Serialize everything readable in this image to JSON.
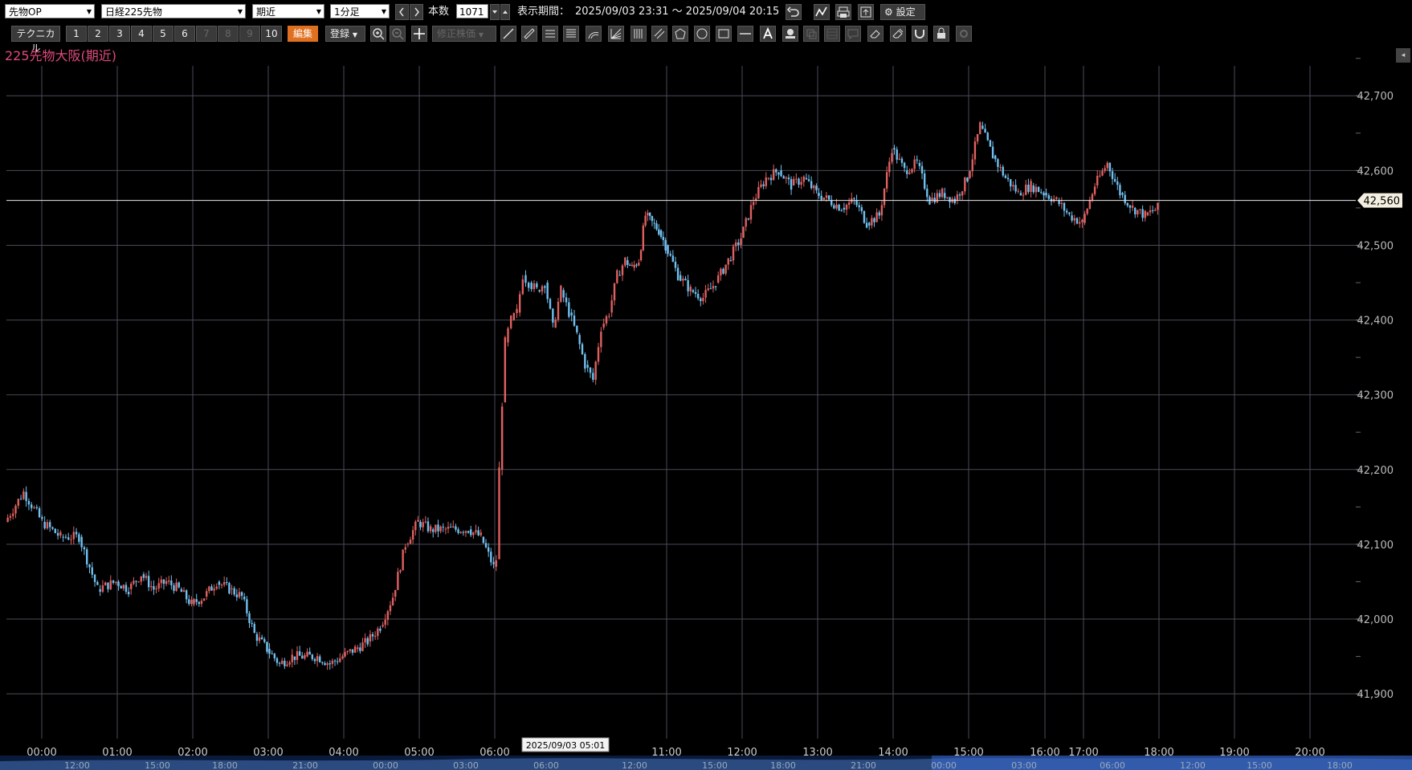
{
  "toolbar": {
    "category_select": "先物OP",
    "instrument_select": "日経225先物",
    "contract_select": "期近",
    "interval_select": "1分足",
    "bars_label": "本数",
    "bars_value": "1071",
    "period_label": "表示期間：",
    "period_value": "2025/09/03 23:31 〜 2025/09/04 20:15",
    "settings_label": "設定",
    "technical_label": "テクニカル",
    "numbers": [
      "1",
      "2",
      "3",
      "4",
      "5",
      "6",
      "7",
      "8",
      "9",
      "10"
    ],
    "edit_label": "編集",
    "register_label": "登録",
    "adjust_label": "修正株価"
  },
  "colors": {
    "up": "#e06060",
    "down": "#70c0f0",
    "grid": "#4a4a5a",
    "title": "#e04a7a",
    "background": "#000000"
  },
  "chart_data": {
    "type": "candlestick",
    "title": "225先物大阪(期近)",
    "ylim": [
      41840,
      42740
    ],
    "y_ticks": [
      "41,900",
      "42,000",
      "42,100",
      "42,200",
      "42,300",
      "42,400",
      "42,500",
      "42,600",
      "42,700"
    ],
    "x_ticks": [
      "00:00",
      "01:00",
      "02:00",
      "03:00",
      "04:00",
      "05:00",
      "06:00",
      "11:00",
      "12:00",
      "13:00",
      "14:00",
      "15:00",
      "16:00",
      "17:00",
      "18:00",
      "19:00",
      "20:00"
    ],
    "current_price": 42560,
    "current_price_label": "42,560",
    "cursor_label": "2025/09/03 05:01",
    "navigator_ticks": [
      "12:00",
      "15:00",
      "18:00",
      "21:00",
      "00:00",
      "03:00",
      "06:00",
      "12:00",
      "15:00",
      "18:00",
      "21:00",
      "00:00",
      "03:00",
      "06:00",
      "12:00",
      "15:00",
      "18:00"
    ],
    "price_path": [
      [
        "00:00",
        42130
      ],
      [
        "00:10",
        42170
      ],
      [
        "00:20",
        42130
      ],
      [
        "00:30",
        42110
      ],
      [
        "00:40",
        42110
      ],
      [
        "00:50",
        42040
      ],
      [
        "01:00",
        42050
      ],
      [
        "01:10",
        42040
      ],
      [
        "01:20",
        42060
      ],
      [
        "01:30",
        42040
      ],
      [
        "01:40",
        42050
      ],
      [
        "01:50",
        42040
      ],
      [
        "02:00",
        42020
      ],
      [
        "02:10",
        42030
      ],
      [
        "02:20",
        42050
      ],
      [
        "02:30",
        42040
      ],
      [
        "02:40",
        42030
      ],
      [
        "02:50",
        41980
      ],
      [
        "03:00",
        41960
      ],
      [
        "03:10",
        41940
      ],
      [
        "03:20",
        41950
      ],
      [
        "03:30",
        41950
      ],
      [
        "03:40",
        41950
      ],
      [
        "03:50",
        41940
      ],
      [
        "04:00",
        41950
      ],
      [
        "04:10",
        41960
      ],
      [
        "04:20",
        41970
      ],
      [
        "04:30",
        41990
      ],
      [
        "04:40",
        42030
      ],
      [
        "04:50",
        42100
      ],
      [
        "05:00",
        42130
      ],
      [
        "05:10",
        42120
      ],
      [
        "05:20",
        42120
      ],
      [
        "05:30",
        42120
      ],
      [
        "05:40",
        42120
      ],
      [
        "05:50",
        42110
      ],
      [
        "06:00",
        42070
      ],
      [
        "06:05",
        42080
      ],
      [
        "06:10",
        42200
      ],
      [
        "06:15",
        42290
      ],
      [
        "06:20",
        42370
      ],
      [
        "06:30",
        42400
      ],
      [
        "06:40",
        42410
      ],
      [
        "06:50",
        42460
      ],
      [
        "07:00",
        42450
      ],
      [
        "07:10",
        42440
      ],
      [
        "07:20",
        42450
      ],
      [
        "07:30",
        42390
      ],
      [
        "07:40",
        42440
      ],
      [
        "07:50",
        42410
      ],
      [
        "08:00",
        42380
      ],
      [
        "08:10",
        42340
      ],
      [
        "08:20",
        42320
      ],
      [
        "08:30",
        42390
      ],
      [
        "08:40",
        42410
      ],
      [
        "08:50",
        42460
      ],
      [
        "09:00",
        42480
      ],
      [
        "09:10",
        42470
      ],
      [
        "09:20",
        42480
      ],
      [
        "09:30",
        42540
      ],
      [
        "09:40",
        42530
      ],
      [
        "09:50",
        42520
      ],
      [
        "10:00",
        42500
      ],
      [
        "10:10",
        42460
      ],
      [
        "10:20",
        42440
      ],
      [
        "10:30",
        42430
      ],
      [
        "10:40",
        42450
      ],
      [
        "10:50",
        42480
      ],
      [
        "11:00",
        42510
      ],
      [
        "11:10",
        42560
      ],
      [
        "11:20",
        42590
      ],
      [
        "11:30",
        42600
      ],
      [
        "11:40",
        42580
      ],
      [
        "11:50",
        42590
      ],
      [
        "12:00",
        42570
      ],
      [
        "12:10",
        42560
      ],
      [
        "12:20",
        42550
      ],
      [
        "12:30",
        42560
      ],
      [
        "12:40",
        42530
      ],
      [
        "12:50",
        42540
      ],
      [
        "13:00",
        42630
      ],
      [
        "13:10",
        42600
      ],
      [
        "13:20",
        42610
      ],
      [
        "13:30",
        42560
      ],
      [
        "13:40",
        42570
      ],
      [
        "13:50",
        42560
      ],
      [
        "14:00",
        42590
      ],
      [
        "14:10",
        42660
      ],
      [
        "14:20",
        42620
      ],
      [
        "14:30",
        42590
      ],
      [
        "14:40",
        42570
      ],
      [
        "14:50",
        42580
      ],
      [
        "15:00",
        42570
      ],
      [
        "15:10",
        42560
      ],
      [
        "15:20",
        42540
      ],
      [
        "15:30",
        42530
      ],
      [
        "15:40",
        42580
      ],
      [
        "15:50",
        42610
      ],
      [
        "16:00",
        42570
      ],
      [
        "16:10",
        42550
      ],
      [
        "16:20",
        42540
      ],
      [
        "16:30",
        42550
      ]
    ]
  }
}
